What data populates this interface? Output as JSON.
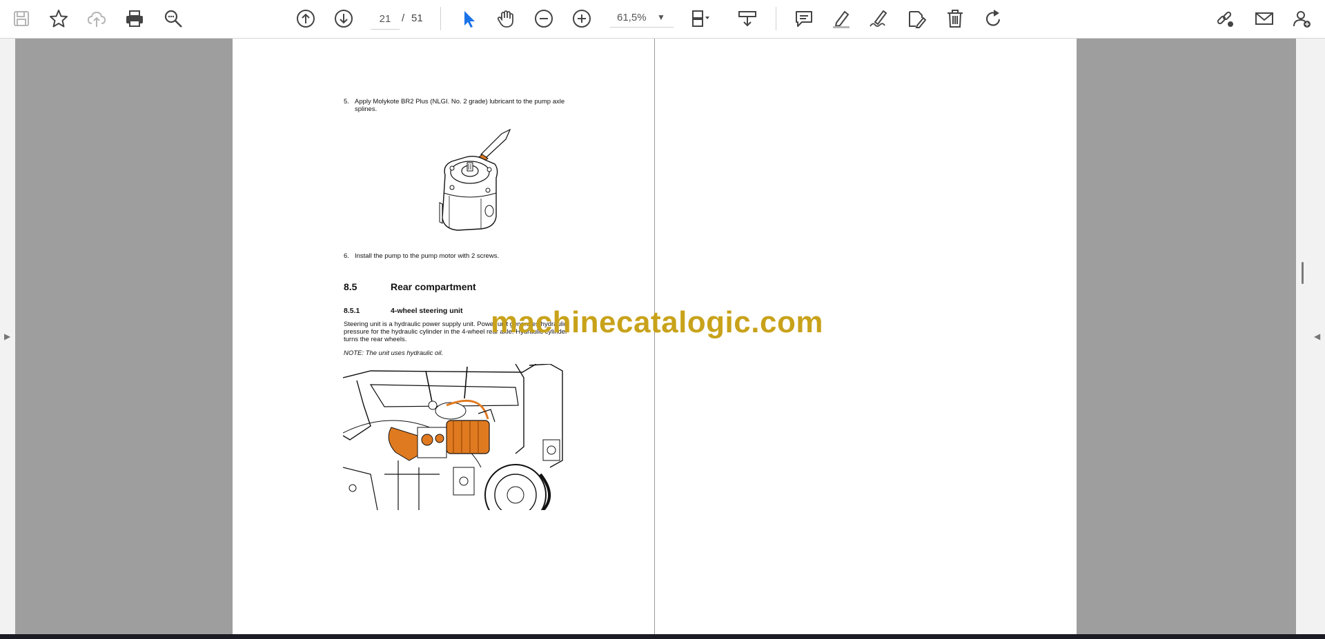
{
  "toolbar": {
    "current_page": "21",
    "page_separator": "/",
    "total_pages": "51",
    "zoom": "61,5%",
    "icons": [
      "save-icon",
      "bookmark-star-icon",
      "cloud-upload-icon",
      "print-icon",
      "find-icon",
      "prev-page-icon",
      "next-page-icon",
      "select-cursor-icon",
      "hand-tool-icon",
      "zoom-out-icon",
      "zoom-in-icon",
      "page-layout-icon",
      "scroll-mode-icon",
      "comment-icon",
      "highlight-icon",
      "sign-icon",
      "stamp-icon",
      "delete-icon",
      "rotate-icon",
      "share-link-icon",
      "email-icon",
      "add-user-icon"
    ]
  },
  "document": {
    "step5_number": "5.",
    "step5_text_line1": "Apply Molykote BR2 Plus (NLGI. No. 2 grade) lubricant to the pump axle",
    "step5_text_line2": "splines.",
    "step6_number": "6.",
    "step6_text": "Install the pump to the pump motor with 2 screws.",
    "section_number": "8.5",
    "section_title": "Rear compartment",
    "subsection_number": "8.5.1",
    "subsection_title": "4-wheel steering unit",
    "para_line1": "Steering unit is a hydraulic power supply unit. Power unit generates hydraulic",
    "para_line2": "pressure for the hydraulic cylinder in the 4-wheel rear axle. Hydraulic cylinder",
    "para_line3": "turns the rear wheels.",
    "note": "NOTE: The unit uses hydraulic oil."
  },
  "watermark": "machinecatalogic.com",
  "colors": {
    "accent_blue": "#1a73e8",
    "watermark": "#c8a21a",
    "part_highlight": "#e07a20"
  }
}
